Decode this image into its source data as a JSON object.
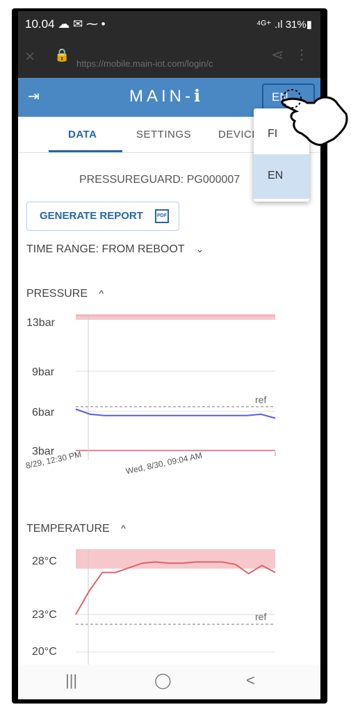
{
  "status": {
    "time": "10.04 ☁ ✉ ⁓ •",
    "right": "⁴ᴳ⁺ .ıl 31%▮"
  },
  "browser": {
    "url": "https://mobile.main-iot.com/login/c",
    "close_icon": "×",
    "lock_icon": "🔒",
    "share_icon": "⋖",
    "more_icon": "⋮"
  },
  "appbar": {
    "logo": "MAIN-ℹ",
    "logout_icon": "⇥",
    "language": "EN"
  },
  "tabs": [
    {
      "label": "DATA"
    },
    {
      "label": "SETTINGS"
    },
    {
      "label": "DEVICE"
    }
  ],
  "device": {
    "title": "PRESSUREGUARD: PG000007"
  },
  "report": {
    "label": "GENERATE REPORT",
    "pdf": "PDF"
  },
  "time_range": {
    "label": "TIME RANGE: FROM REBOOT",
    "chevron": "⌄"
  },
  "pressure": {
    "label": "PRESSURE",
    "chevron": "^",
    "y_labels": [
      "13bar",
      "9bar",
      "6bar",
      "3bar"
    ],
    "ref_label": "ref",
    "x_labels": [
      "8/29, 12:30 PM",
      "Wed, 8/30, 09:04 AM"
    ]
  },
  "temperature": {
    "label": "TEMPERATURE",
    "chevron": "^",
    "y_labels": [
      "28°C",
      "23°C",
      "20°C"
    ],
    "ref_label": "ref"
  },
  "dropdown": {
    "items": [
      {
        "label": "FI"
      },
      {
        "label": "EN"
      }
    ]
  },
  "navbar": {
    "recents": "|||",
    "home": "◯",
    "back": "<"
  },
  "chart_data": [
    {
      "type": "line",
      "title": "PRESSURE",
      "ylabel": "",
      "ytick_labels": [
        "3bar",
        "6bar",
        "9bar",
        "13bar"
      ],
      "ylim": [
        3,
        13
      ],
      "ref": 6.3,
      "x_tick_labels": [
        "8/29, 12:30 PM",
        "Wed, 8/30, 09:04 AM"
      ],
      "series": [
        {
          "values": [
            6.2,
            5.8,
            5.7,
            5.7,
            5.7,
            5.7,
            5.7,
            5.7,
            5.7,
            5.7,
            5.7,
            5.7,
            5.7,
            5.8,
            5.5
          ]
        }
      ],
      "color": "#5a5af0"
    },
    {
      "type": "line",
      "title": "TEMPERATURE",
      "ylabel": "",
      "ytick_labels": [
        "20°C",
        "23°C",
        "28°C"
      ],
      "ref": 22.7,
      "series": [
        {
          "values": [
            23,
            25,
            26.6,
            26.6,
            27,
            27.4,
            27.5,
            27.4,
            27.4,
            27.5,
            27.5,
            27.5,
            27.3,
            26.5,
            27.2,
            26.6
          ]
        }
      ],
      "color": "#e55f6a"
    }
  ]
}
